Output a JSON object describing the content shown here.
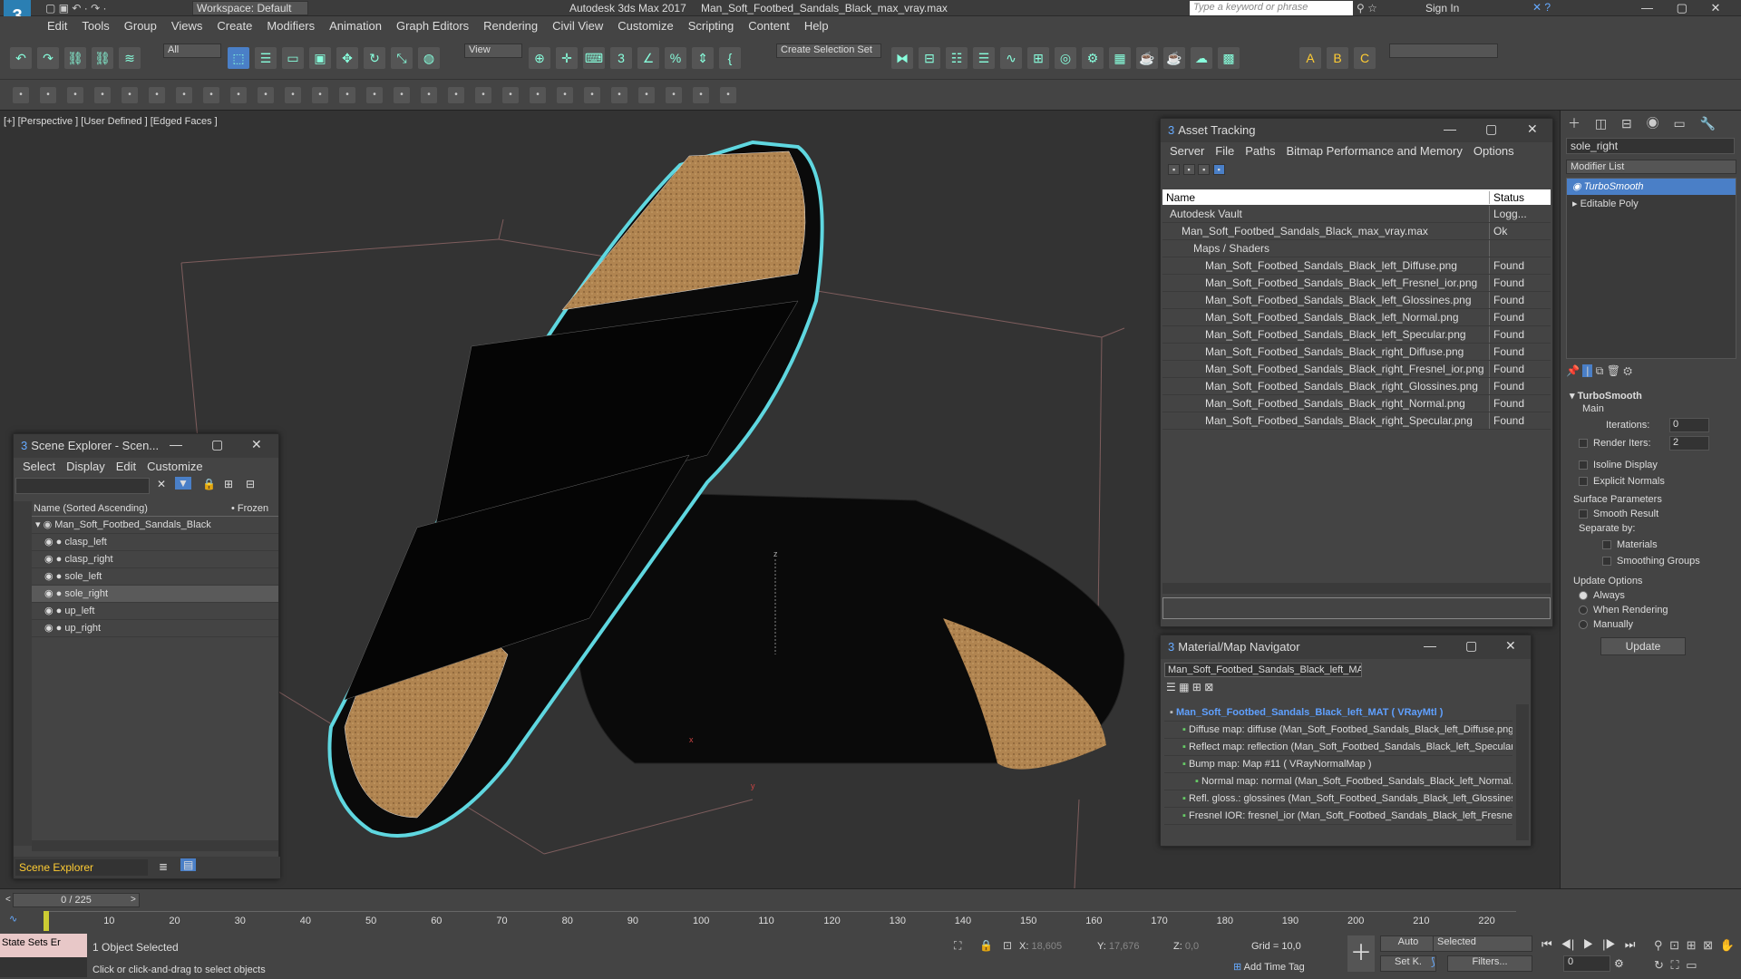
{
  "title_bar": {
    "workspace_label": "Workspace: Default",
    "app_title": "Autodesk 3ds Max 2017",
    "file_name": "Man_Soft_Footbed_Sandals_Black_max_vray.max",
    "search_placeholder": "Type a keyword or phrase",
    "sign_in": "Sign In"
  },
  "menu": [
    "Edit",
    "Tools",
    "Group",
    "Views",
    "Create",
    "Modifiers",
    "Animation",
    "Graph Editors",
    "Rendering",
    "Civil View",
    "Customize",
    "Scripting",
    "Content",
    "Help"
  ],
  "toolbar": {
    "filter_value": "All",
    "view_value": "View",
    "selection_set": "Create Selection Set"
  },
  "viewport": {
    "label": "[+] [Perspective ] [User Defined ] [Edged Faces ]",
    "axis_z": "z",
    "axis_x": "x",
    "axis_y": "y"
  },
  "asset_tracking": {
    "title": "Asset Tracking",
    "menu": [
      "Server",
      "File",
      "Paths",
      "Bitmap Performance and Memory",
      "Options"
    ],
    "col_name": "Name",
    "col_status": "Status",
    "rows": [
      {
        "name": "Autodesk Vault",
        "status": "Logg...",
        "indent": 0
      },
      {
        "name": "Man_Soft_Footbed_Sandals_Black_max_vray.max",
        "status": "Ok",
        "indent": 1
      },
      {
        "name": "Maps / Shaders",
        "status": "",
        "indent": 2
      },
      {
        "name": "Man_Soft_Footbed_Sandals_Black_left_Diffuse.png",
        "status": "Found",
        "indent": 3
      },
      {
        "name": "Man_Soft_Footbed_Sandals_Black_left_Fresnel_ior.png",
        "status": "Found",
        "indent": 3
      },
      {
        "name": "Man_Soft_Footbed_Sandals_Black_left_Glossines.png",
        "status": "Found",
        "indent": 3
      },
      {
        "name": "Man_Soft_Footbed_Sandals_Black_left_Normal.png",
        "status": "Found",
        "indent": 3
      },
      {
        "name": "Man_Soft_Footbed_Sandals_Black_left_Specular.png",
        "status": "Found",
        "indent": 3
      },
      {
        "name": "Man_Soft_Footbed_Sandals_Black_right_Diffuse.png",
        "status": "Found",
        "indent": 3
      },
      {
        "name": "Man_Soft_Footbed_Sandals_Black_right_Fresnel_ior.png",
        "status": "Found",
        "indent": 3
      },
      {
        "name": "Man_Soft_Footbed_Sandals_Black_right_Glossines.png",
        "status": "Found",
        "indent": 3
      },
      {
        "name": "Man_Soft_Footbed_Sandals_Black_right_Normal.png",
        "status": "Found",
        "indent": 3
      },
      {
        "name": "Man_Soft_Footbed_Sandals_Black_right_Specular.png",
        "status": "Found",
        "indent": 3
      }
    ]
  },
  "scene_explorer": {
    "title": "Scene Explorer - Scen...",
    "menu": [
      "Select",
      "Display",
      "Edit",
      "Customize"
    ],
    "col_name": "Name (Sorted Ascending)",
    "col_frozen": "Frozen",
    "root": "Man_Soft_Footbed_Sandals_Black",
    "items": [
      "clasp_left",
      "clasp_right",
      "sole_left",
      "sole_right",
      "up_left",
      "up_right"
    ],
    "selected": "sole_right",
    "footer": "Scene Explorer"
  },
  "material_navigator": {
    "title": "Material/Map Navigator",
    "field": "Man_Soft_Footbed_Sandals_Black_left_MAT  (",
    "items": [
      "Man_Soft_Footbed_Sandals_Black_left_MAT  ( VRayMtl )",
      "Diffuse map: diffuse (Man_Soft_Footbed_Sandals_Black_left_Diffuse.png)",
      "Reflect map: reflection (Man_Soft_Footbed_Sandals_Black_left_Specular.p",
      "Bump map: Map #11  ( VRayNormalMap )",
      "Normal map: normal (Man_Soft_Footbed_Sandals_Black_left_Normal.pn",
      "Refl. gloss.: glossines (Man_Soft_Footbed_Sandals_Black_left_Glossines.pr",
      "Fresnel IOR: fresnel_ior (Man_Soft_Footbed_Sandals_Black_left_Fresnel_i"
    ]
  },
  "command_panel": {
    "object_name": "sole_right",
    "modifier_list": "Modifier List",
    "stack": [
      "TurboSmooth",
      "Editable Poly"
    ],
    "turbosmooth": {
      "header": "TurboSmooth",
      "main": "Main",
      "iterations_label": "Iterations:",
      "iterations": "0",
      "render_iters_label": "Render Iters:",
      "render_iters": "2",
      "isoline": "Isoline Display",
      "explicit": "Explicit Normals",
      "surface": "Surface Parameters",
      "smooth_result": "Smooth Result",
      "separate_by": "Separate by:",
      "materials": "Materials",
      "smoothing_groups": "Smoothing Groups",
      "update_options": "Update Options",
      "always": "Always",
      "when_rendering": "When Rendering",
      "manually": "Manually",
      "update_btn": "Update"
    }
  },
  "timeline": {
    "frame": "0 / 225",
    "ticks": [
      "10",
      "20",
      "30",
      "40",
      "50",
      "60",
      "70",
      "80",
      "90",
      "100",
      "110",
      "120",
      "130",
      "140",
      "150",
      "160",
      "170",
      "180",
      "190",
      "200",
      "210",
      "220"
    ]
  },
  "status": {
    "state_sets": "State Sets Er",
    "selected": "1 Object Selected",
    "hint": "Click or click-and-drag to select objects",
    "x_label": "X:",
    "x_val": "18,605",
    "y_label": "Y:",
    "y_val": "17,676",
    "z_label": "Z:",
    "z_val": "0,0",
    "grid": "Grid = 10,0",
    "add_time_tag": "Add Time Tag",
    "auto": "Auto",
    "selected_mode": "Selected",
    "set_k": "Set K.",
    "filters": "Filters...",
    "frame_val": "0"
  },
  "colors": {
    "accent": "#5fd7e0",
    "highlight": "#4a7fc7"
  }
}
